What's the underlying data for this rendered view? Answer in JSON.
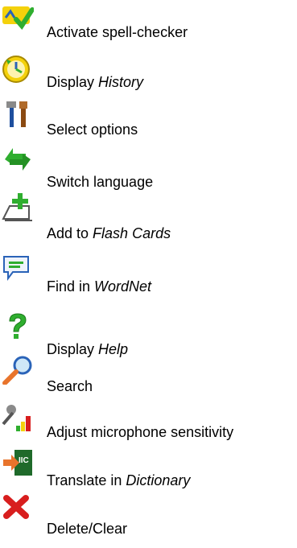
{
  "items": [
    {
      "icon": "spell-check-icon",
      "text": "Activate spell-checker",
      "em": ""
    },
    {
      "icon": "history-clock-icon",
      "text": "Display ",
      "em": "History"
    },
    {
      "icon": "tools-options-icon",
      "text": "Select options",
      "em": ""
    },
    {
      "icon": "switch-language-arrows-icon",
      "text": "Switch language",
      "em": ""
    },
    {
      "icon": "add-flash-card-icon",
      "text": "Add to ",
      "em": "Flash Cards"
    },
    {
      "icon": "wordnet-chat-icon",
      "text": "Find in ",
      "em": "WordNet"
    },
    {
      "icon": "help-question-icon",
      "text": "Display ",
      "em": "Help"
    },
    {
      "icon": "search-magnifier-icon",
      "text": "Search",
      "em": ""
    },
    {
      "icon": "microphone-sensitivity-icon",
      "text": "Adjust microphone sensitivity",
      "em": ""
    },
    {
      "icon": "translate-dictionary-icon",
      "text": "Translate in ",
      "em": "Dictionary"
    },
    {
      "icon": "delete-clear-icon",
      "text": "Delete/Clear",
      "em": ""
    }
  ],
  "colors": {
    "green": "#2fae2f",
    "yellow": "#f4d10b",
    "orange": "#e8742c",
    "red": "#d81e1e",
    "blue": "#2a63b8"
  }
}
